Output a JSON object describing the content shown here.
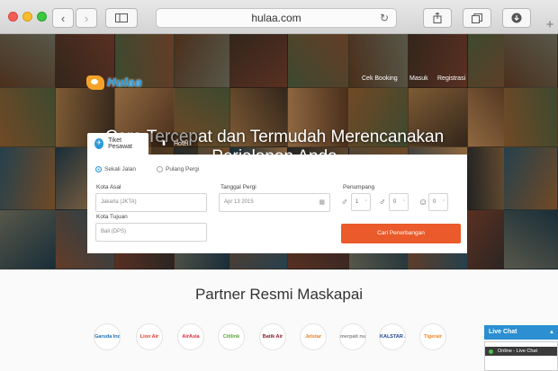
{
  "browser": {
    "url": "hulaa.com",
    "icons": [
      "back-icon",
      "forward-icon",
      "sidebar-icon",
      "reload-icon",
      "share-icon",
      "tabs-icon",
      "download-icon",
      "new-tab-icon"
    ]
  },
  "site": {
    "logo_text": "Hulaa",
    "nav": {
      "check_booking": "Cek Booking",
      "login": "Masuk",
      "register": "Registrasi"
    },
    "headline": "Cara Tercepat dan Termudah Merencanakan Perjalanan Anda"
  },
  "search": {
    "tabs": [
      {
        "label": "Tiket Pesawat",
        "active": true
      },
      {
        "label": "Hotel",
        "active": false
      }
    ],
    "trip_type": {
      "one_way": "Sekali Jalan",
      "round_trip": "Pulang Pergi",
      "selected": "Sekali Jalan"
    },
    "origin": {
      "label": "Kota Asal",
      "value": "Jakarta (JKTA)"
    },
    "destination": {
      "label": "Kota Tujuan",
      "value": "Bali (DPS)"
    },
    "departure": {
      "label": "Tanggal Pergi",
      "value": "Apr 13 2015"
    },
    "passengers": {
      "label": "Penumpang",
      "adult": "1",
      "child": "0",
      "infant": "0"
    },
    "submit_label": "Cari Penerbangan",
    "accent_color": "#ea5a2a"
  },
  "partners": {
    "title": "Partner Resmi Maskapai",
    "airlines": [
      {
        "name": "Garuda Indonesia",
        "color": "#1b6fb3"
      },
      {
        "name": "Lion Air",
        "color": "#e23b2a"
      },
      {
        "name": "AirAsia",
        "color": "#e32636"
      },
      {
        "name": "Citilink",
        "color": "#5aa43a"
      },
      {
        "name": "Batik Air",
        "color": "#8a1c2b"
      },
      {
        "name": "Jetstar",
        "color": "#f47a20"
      },
      {
        "name": "merpati nusantara",
        "color": "#888888"
      },
      {
        "name": "KALSTAR AVIATION",
        "color": "#1c3f8c"
      },
      {
        "name": "Tigerair",
        "color": "#f58220"
      }
    ]
  },
  "live_chat": {
    "header": "Live Chat",
    "status": "Online - Live Chat"
  }
}
